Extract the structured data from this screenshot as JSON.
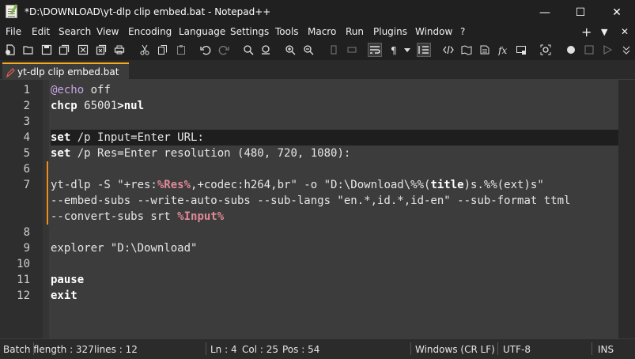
{
  "window": {
    "title": "*D:\\DOWNLOAD\\yt-dlp clip embed.bat - Notepad++",
    "minimize_glyph": "—",
    "maximize_glyph": "☐",
    "close_glyph": "✕"
  },
  "menu": {
    "items": [
      "File",
      "Edit",
      "Search",
      "View",
      "Encoding",
      "Language",
      "Settings",
      "Tools",
      "Macro",
      "Run",
      "Plugins",
      "Window",
      "?"
    ],
    "plus_glyph": "+",
    "dropdown_glyph": "▼",
    "close_glyph": "✕"
  },
  "tab": {
    "label": "yt-dlp clip embed.bat"
  },
  "editor": {
    "line_numbers": [
      "1",
      "2",
      "3",
      "4",
      "5",
      "6",
      "7",
      "",
      "",
      "8",
      "9",
      "10",
      "11",
      "12"
    ],
    "lines": {
      "l1_a": "@echo",
      "l1_b": " off",
      "l2_a": "chcp",
      "l2_b": " 65001",
      "l2_c": ">",
      "l2_d": "nul",
      "l4_a": "set",
      "l4_b": " /p Input=Enter URL:",
      "l5_a": "set",
      "l5_b": " /p Res=Enter resolution (480, 720, 1080):",
      "l7_a": "yt-dlp -S \"+res:",
      "l7_b": "%Res%",
      "l7_c": ",+codec:h264,br\" -o \"D:\\Download\\%%(",
      "l7_d": "title",
      "l7_e": ")s.%%(ext)s\"",
      "l7w1": "--embed-subs --write-auto-subs --sub-langs \"en.*,id.*,id-en\" --sub-format ttml",
      "l7w2_a": "--convert-subs srt ",
      "l7w2_b": "%Input%",
      "l9_a": "explorer",
      "l9_b": " \"D:\\Download\"",
      "l11": "pause",
      "l12": "exit"
    }
  },
  "status": {
    "file_type": "Batch f",
    "length": "length : 327",
    "lines": "lines : 12",
    "ln": "Ln : 4",
    "col": "Col : 25",
    "pos": "Pos : 54",
    "eol": "Windows (CR LF)",
    "encoding": "UTF-8",
    "mode": "INS"
  },
  "colors": {
    "accent_tab": "#f7a81b",
    "change_marker": "#f48c1a",
    "variable": "#e08a96",
    "editor_bg": "#3c3c3c",
    "caret_line": "#1e1e1e"
  }
}
